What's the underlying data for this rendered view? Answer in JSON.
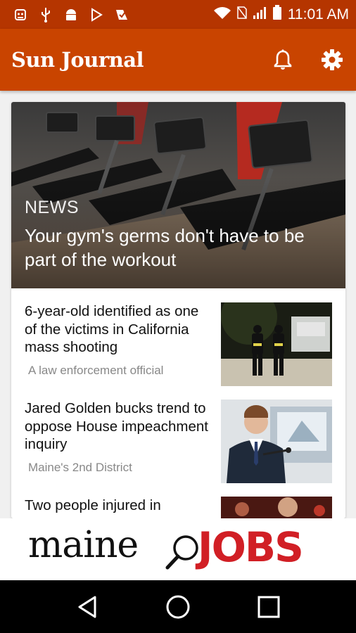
{
  "status_bar": {
    "time": "11:01 AM",
    "left_icons": [
      "app-icon",
      "usb-icon",
      "android-icon",
      "play-store-icon",
      "check-app-icon"
    ],
    "right_icons": [
      "wifi-icon",
      "no-sim-icon",
      "signal-icon",
      "battery-icon"
    ]
  },
  "app_bar": {
    "title": "Sun Journal",
    "actions": [
      "bell-icon",
      "gear-icon"
    ],
    "color": "#c94400"
  },
  "hero": {
    "section": "NEWS",
    "headline": "Your gym's germs don't have to be part of the workout"
  },
  "articles": [
    {
      "headline": "6-year-old identified as one of the victims in California mass shooting",
      "subtitle": "A law enforcement official"
    },
    {
      "headline": "Jared Golden bucks trend to oppose House impeachment inquiry",
      "subtitle": "Maine's 2nd District"
    },
    {
      "headline": "Two people injured in",
      "subtitle": ""
    }
  ],
  "ad": {
    "word1": "maine",
    "word2": "JOBS"
  },
  "nav_bar": {
    "buttons": [
      "back-icon",
      "home-icon",
      "recents-icon"
    ]
  }
}
